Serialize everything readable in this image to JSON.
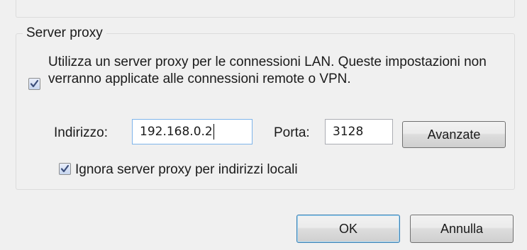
{
  "proxy": {
    "legend": "Server proxy",
    "use_proxy_checked": true,
    "use_proxy_text": "Utilizza un server proxy per le connessioni LAN. Queste impostazioni non verranno applicate alle connessioni remote o VPN.",
    "address_label": "Indirizzo:",
    "address_value": "192.168.0.2",
    "port_label": "Porta:",
    "port_value": "3128",
    "advanced_label": "Avanzate",
    "bypass_local_checked": true,
    "bypass_local_text": "Ignora server proxy per indirizzi locali"
  },
  "footer": {
    "ok_label": "OK",
    "cancel_label": "Annulla"
  },
  "icons": {
    "checkmark": "check-icon"
  },
  "colors": {
    "background": "#f0f0f0",
    "check": "#3b4e7a",
    "default_button_border": "#3c7fb1",
    "focus_border": "#7eb4ea"
  }
}
